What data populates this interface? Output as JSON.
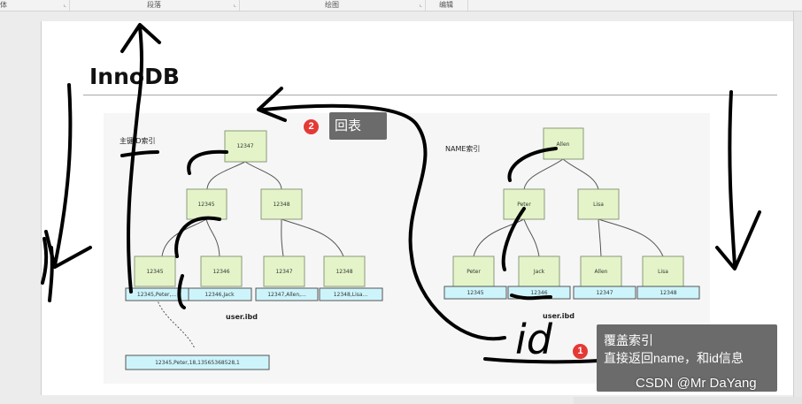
{
  "ribbon": {
    "groups": [
      {
        "label": "体"
      },
      {
        "label": "段落"
      },
      {
        "label": "绘图"
      },
      {
        "label": "编辑"
      }
    ]
  },
  "heading": "InnoDB",
  "primary_tree": {
    "caption": "主键ID索引",
    "root": "12347",
    "internal": [
      "12345",
      "12348"
    ],
    "leaves": [
      "12345",
      "12346",
      "12347",
      "12348"
    ],
    "rows": [
      "12345,Peter,...",
      "12346,Jack",
      "12347,Allen,...",
      "12348,Lisa..."
    ],
    "file": "user.ibd",
    "detail_row": "12345,Peter,18,13565368528,1"
  },
  "name_tree": {
    "caption": "NAME索引",
    "root": "Allen",
    "internal": [
      "Peter",
      "Lisa"
    ],
    "leaves": [
      "Peter",
      "Jack",
      "Allen",
      "Lisa"
    ],
    "rows": [
      "12345",
      "12346",
      "12347",
      "12348"
    ],
    "file": "user.ibd"
  },
  "ink_annotation": "id",
  "tooltip_back": {
    "badge": "2",
    "text": "回表"
  },
  "tooltip_cover": {
    "badge": "1",
    "line1": "覆盖索引",
    "line2": "直接返回name，和id信息"
  },
  "watermark": "CSDN @Mr DaYang"
}
